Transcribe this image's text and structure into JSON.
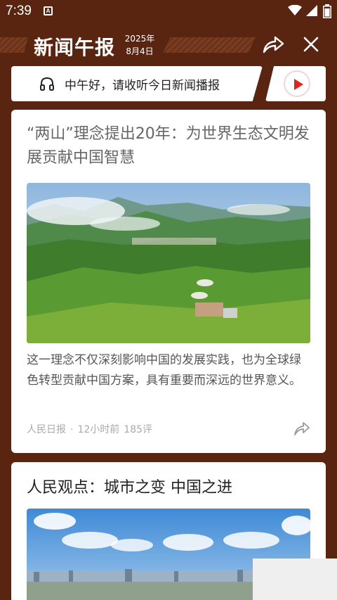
{
  "status_bar": {
    "time": "7:39",
    "notif_letter": "A"
  },
  "header": {
    "title": "新闻午报",
    "date_year": "2025年",
    "date_day": "8月4日"
  },
  "audio": {
    "label": "中午好，请收听今日新闻播报"
  },
  "articles": [
    {
      "title": "“两山”理念提出20年：为世界生态文明发展贡献中国智慧",
      "summary": "这一理念不仅深刻影响中国的发展实践，也为全球绿色转型贡献中国方案，具有重要而深远的世界意义。",
      "source": "人民日报",
      "time": "12小时前",
      "comments": "185评"
    },
    {
      "title": "人民观点：城市之变 中国之进"
    }
  ],
  "colors": {
    "background": "#5a2510",
    "play_accent": "#e0231e"
  }
}
